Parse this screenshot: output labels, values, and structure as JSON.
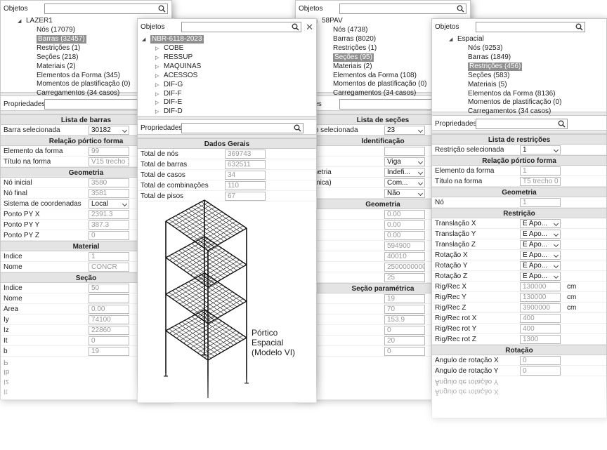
{
  "w1": {
    "objects_label": "Objetos",
    "root": "LAZER1",
    "items": [
      "Nós (17079)",
      "Barras (32457)",
      "Restrições (1)",
      "Seções (218)",
      "Materiais (2)",
      "Elementos da Forma (345)",
      "Momentos de plastificação (0)",
      "Carregamentos (34 casos)"
    ],
    "props_label": "Propriedades",
    "sections": [
      {
        "title": "Lista de barras",
        "rows": [
          {
            "k": "Barra selecionada",
            "v": "30182",
            "dd": true
          }
        ]
      },
      {
        "title": "Relação pórtico forma",
        "rows": [
          {
            "k": "Elemento da forma",
            "v": "99"
          },
          {
            "k": "Título na forma",
            "v": "V15 trecho 1"
          }
        ]
      },
      {
        "title": "Geometria",
        "rows": [
          {
            "k": "Nó inicial",
            "v": "3580"
          },
          {
            "k": "Nó final",
            "v": "3581"
          },
          {
            "k": "Sistema de coordenadas",
            "v": "Local",
            "dd": true
          },
          {
            "k": "Ponto PY X",
            "v": "2391.3"
          },
          {
            "k": "Ponto PY Y",
            "v": "387.3"
          },
          {
            "k": "Ponto PY Z",
            "v": "0"
          }
        ]
      },
      {
        "title": "Material",
        "rows": [
          {
            "k": "Índice",
            "v": "1"
          },
          {
            "k": "Nome",
            "v": "CONCR"
          }
        ]
      },
      {
        "title": "Seção",
        "rows": [
          {
            "k": "Índice",
            "v": "50"
          },
          {
            "k": "Nome",
            "v": ""
          },
          {
            "k": "Área",
            "v": "0.00"
          },
          {
            "k": "Iy",
            "v": "74100"
          },
          {
            "k": "Iz",
            "v": "22860"
          },
          {
            "k": "It",
            "v": "0"
          },
          {
            "k": "b",
            "v": "19"
          }
        ]
      }
    ],
    "ghost": [
      "P",
      "Ib",
      "Iz",
      "It"
    ]
  },
  "w3": {
    "objects_label": "Objetos",
    "root": "58PAV",
    "items": [
      "Nós (4738)",
      "Barras (8020)",
      "Restrições (1)",
      "Seções (95)",
      "Materiais (2)",
      "Elementos da Forma (108)",
      "Momentos de plastificação (0)",
      "Carregamentos (34 casos)"
    ],
    "props_label": "edades",
    "sections": [
      {
        "title": "Lista de seções",
        "rows": [
          {
            "k": "Seção selecionada",
            "v": "23",
            "dd": true
          }
        ]
      },
      {
        "title": "Identificação",
        "rows": [
          {
            "k": "",
            "v": ""
          },
          {
            "k": "",
            "v": "Viga",
            "dd": true
          },
          {
            "k": "Geometria",
            "v": "Indefi...",
            "dd": true
          },
          {
            "k": "(dinâmica)",
            "v": "Com...",
            "dd": true
          },
          {
            "k": "e",
            "v": "Não",
            "dd": true
          }
        ]
      },
      {
        "title": "Geometria",
        "rows": [
          {
            "k": "",
            "v": "0.00"
          },
          {
            "k": "",
            "v": "0.00"
          },
          {
            "k": "",
            "v": "0.00"
          },
          {
            "k": "",
            "v": "594900"
          },
          {
            "k": "",
            "v": "40010"
          },
          {
            "k": "",
            "v": "2500000000"
          },
          {
            "k": "r It",
            "v": "25"
          }
        ]
      },
      {
        "title": "Seção paramétrica",
        "rows": [
          {
            "k": "",
            "v": "19"
          },
          {
            "k": "",
            "v": "70"
          },
          {
            "k": "",
            "v": "153.9"
          },
          {
            "k": "",
            "v": "0"
          },
          {
            "k": "",
            "v": "20"
          },
          {
            "k": "",
            "v": "0"
          }
        ]
      }
    ],
    "ghost": [
      "0",
      "0"
    ]
  },
  "w2": {
    "objects_label": "Objetos",
    "root": "NBR-6118-2023",
    "items": [
      "COBE",
      "RESSUP",
      "MAQUINAS",
      "ACESSOS",
      "DIF-G",
      "DIF-F",
      "DIF-E",
      "DIF-D"
    ],
    "props_label": "Propriedades",
    "section": "Dados Gerais",
    "rows": [
      {
        "k": "Total de nós",
        "v": "369743"
      },
      {
        "k": "Total de barras",
        "v": "632511"
      },
      {
        "k": "Total de casos",
        "v": "34"
      },
      {
        "k": "Total de combinações",
        "v": "110"
      },
      {
        "k": "Total de pisos",
        "v": "67"
      }
    ],
    "caption": [
      "Pórtico",
      "Espacial",
      "(Modelo VI)"
    ]
  },
  "w4": {
    "objects_label": "Objetos",
    "root": "Espacial",
    "items": [
      "Nós (9253)",
      "Barras (1849)",
      "Restrições (456)",
      "Seções (583)",
      "Materiais (5)",
      "Elementos da Forma (8136)",
      "Momentos de plastificação (0)",
      "Carregamentos (34 casos)"
    ],
    "props_label": "Propriedades",
    "sections": [
      {
        "title": "Lista de restrições",
        "rows": [
          {
            "k": "Restrição selecionada",
            "v": "1",
            "dd": true
          }
        ]
      },
      {
        "title": "Relação pórtico forma",
        "rows": [
          {
            "k": "Elemento da forma",
            "v": "1"
          },
          {
            "k": "Título na forma",
            "v": "T5 trecho 0"
          }
        ]
      },
      {
        "title": "Geometria",
        "rows": [
          {
            "k": "Nó",
            "v": "1"
          }
        ]
      },
      {
        "title": "Restrição",
        "rows": [
          {
            "k": "Translação X",
            "v": "E Apo...",
            "dd": true
          },
          {
            "k": "Translação Y",
            "v": "E Apo...",
            "dd": true
          },
          {
            "k": "Translação Z",
            "v": "E Apo...",
            "dd": true
          },
          {
            "k": "Rotação X",
            "v": "E Apo...",
            "dd": true
          },
          {
            "k": "Rotação Y",
            "v": "E Apo...",
            "dd": true
          },
          {
            "k": "Rotação Z",
            "v": "E Apo...",
            "dd": true
          },
          {
            "k": "Rig/Rec X",
            "v": "130000",
            "u": "cm"
          },
          {
            "k": "Rig/Rec Y",
            "v": "130000",
            "u": "cm"
          },
          {
            "k": "Rig/Rec Z",
            "v": "3900000",
            "u": "cm"
          },
          {
            "k": "Rig/Rec rot X",
            "v": "400"
          },
          {
            "k": "Rig/Rec rot Y",
            "v": "400"
          },
          {
            "k": "Rig/Rec rot Z",
            "v": "1300"
          }
        ]
      },
      {
        "title": "Rotação",
        "rows": [
          {
            "k": "Ângulo de rotação X",
            "v": "0"
          },
          {
            "k": "Ângulo de rotação Y",
            "v": "0"
          }
        ]
      }
    ],
    "ghost": [
      "Ângulo de rotação Y",
      "Ângulo de rotação X"
    ]
  }
}
